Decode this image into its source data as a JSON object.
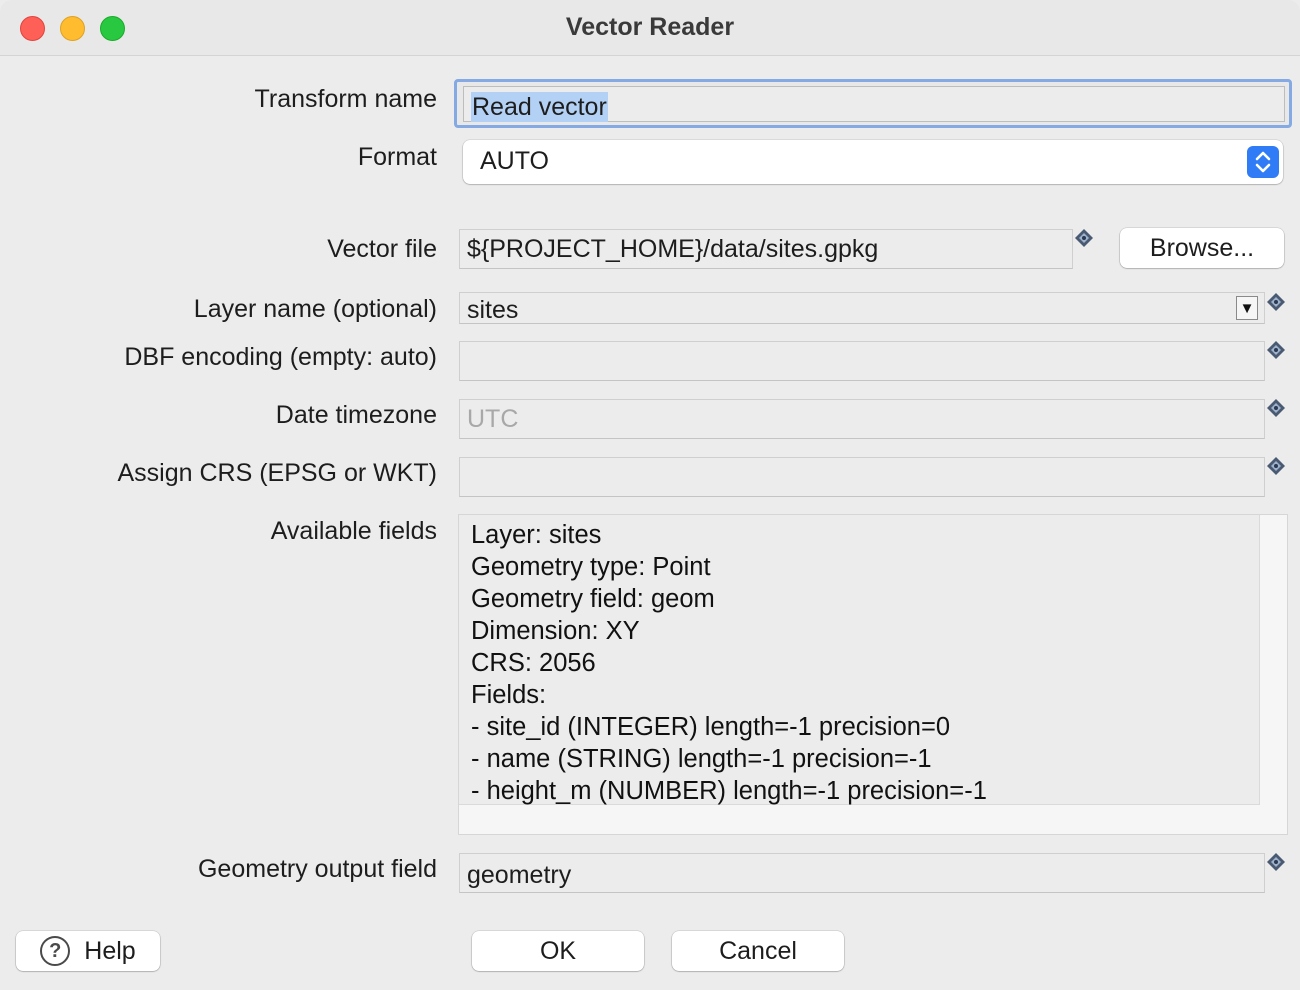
{
  "window": {
    "title": "Vector Reader"
  },
  "form": {
    "transform_name": {
      "label": "Transform name",
      "value": "Read vector"
    },
    "format": {
      "label": "Format",
      "value": "AUTO"
    },
    "vector_file": {
      "label": "Vector file",
      "value": "${PROJECT_HOME}/data/sites.gpkg",
      "browse_label": "Browse..."
    },
    "layer_name": {
      "label": "Layer name (optional)",
      "value": "sites"
    },
    "dbf_encoding": {
      "label": "DBF encoding (empty: auto)",
      "value": ""
    },
    "date_timezone": {
      "label": "Date timezone",
      "placeholder": "UTC"
    },
    "assign_crs": {
      "label": "Assign CRS (EPSG or WKT)",
      "value": ""
    },
    "available_fields": {
      "label": "Available fields",
      "lines": [
        "Layer: sites",
        "Geometry type: Point",
        "Geometry field: geom",
        "Dimension: XY",
        "CRS: 2056",
        "Fields:",
        "- site_id (INTEGER) length=-1 precision=0",
        "- name (STRING) length=-1 precision=-1",
        "- height_m (NUMBER) length=-1 precision=-1"
      ]
    },
    "geometry_output_field": {
      "label": "Geometry output field",
      "value": "geometry"
    }
  },
  "buttons": {
    "help": "Help",
    "ok": "OK",
    "cancel": "Cancel"
  },
  "icons": {
    "variable": "variable-diamond-icon",
    "help": "question-mark-icon",
    "combo": "dropdown-arrow-icon",
    "stepper": "updown-chevron-icon"
  },
  "colors": {
    "accent": "#2f7cf6",
    "focus_ring": "#85a9e3",
    "selection": "#b3d1f5"
  }
}
